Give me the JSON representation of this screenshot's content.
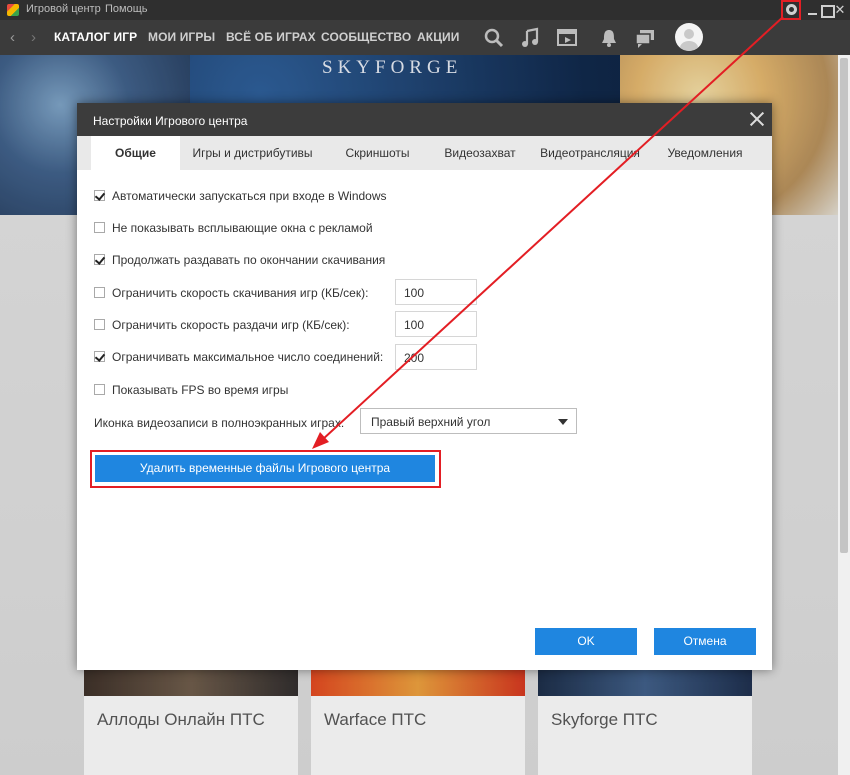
{
  "titlebar": {
    "app_name": "Игровой центр",
    "help": "Помощь"
  },
  "nav": {
    "items": [
      {
        "label": "КАТАЛОГ ИГР",
        "active": true
      },
      {
        "label": "МОИ ИГРЫ",
        "active": false
      },
      {
        "label": "ВСЁ ОБ ИГРАХ",
        "active": false
      },
      {
        "label": "СООБЩЕСТВО",
        "active": false
      },
      {
        "label": "АКЦИИ",
        "active": false
      }
    ],
    "icons": [
      "search-icon",
      "music-icon",
      "video-icon",
      "bell-icon",
      "chat-icon"
    ]
  },
  "banner": {
    "logo_text": "SKYFORGE"
  },
  "game_cards": [
    {
      "name": "Аллоды Онлайн ПТС"
    },
    {
      "name": "Warface ПТС"
    },
    {
      "name": "Skyforge ПТС"
    }
  ],
  "dialog": {
    "title": "Настройки Игрового центра",
    "tabs": [
      {
        "label": "Общие",
        "active": true
      },
      {
        "label": "Игры и дистрибутивы",
        "active": false
      },
      {
        "label": "Скриншоты",
        "active": false
      },
      {
        "label": "Видеозахват",
        "active": false
      },
      {
        "label": "Видеотрансляция",
        "active": false
      },
      {
        "label": "Уведомления",
        "active": false
      }
    ],
    "options": [
      {
        "label": "Автоматически запускаться при входе в Windows",
        "checked": true
      },
      {
        "label": "Не показывать всплывающие окна с рекламой",
        "checked": false
      },
      {
        "label": "Продолжать раздавать по окончании скачивания",
        "checked": true
      },
      {
        "label": "Ограничить скорость скачивания игр (КБ/сек):",
        "checked": false,
        "value": "100"
      },
      {
        "label": "Ограничить скорость раздачи игр (КБ/сек):",
        "checked": false,
        "value": "100"
      },
      {
        "label": "Ограничивать максимальное число соединений:",
        "checked": true,
        "value": "200"
      },
      {
        "label": "Показывать FPS во время игры",
        "checked": false
      }
    ],
    "record_icon_label": "Иконка видеозаписи в полноэкранных играх:",
    "record_icon_value": "Правый верхний угол",
    "delete_button": "Удалить временные файлы Игрового центра",
    "ok_button": "OK",
    "cancel_button": "Отмена"
  },
  "colors": {
    "accent": "#1f86e0",
    "highlight": "#e31e24",
    "titlebar": "#2f2f2f",
    "navbar": "#3b3b3b"
  }
}
